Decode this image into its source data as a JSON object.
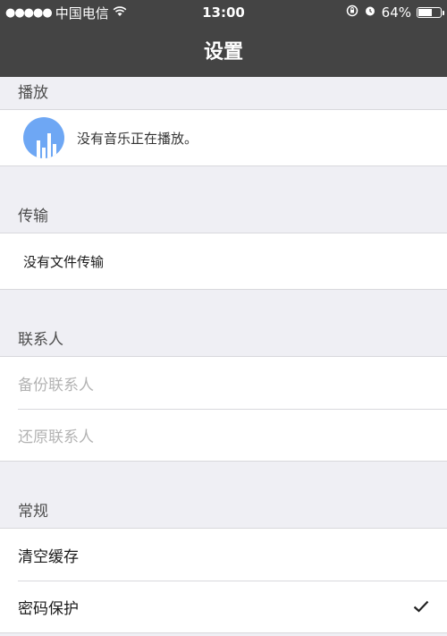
{
  "status_bar": {
    "signal": "●●●●●",
    "carrier": "中国电信",
    "time": "13:00",
    "battery_percent": "64%",
    "battery_level": 0.64
  },
  "nav": {
    "title": "设置"
  },
  "sections": {
    "playback": {
      "header": "播放",
      "status": "没有音乐正在播放。"
    },
    "transfer": {
      "header": "传输",
      "status": "没有文件传输"
    },
    "contacts": {
      "header": "联系人",
      "backup": "备份联系人",
      "restore": "还原联系人"
    },
    "general": {
      "header": "常规",
      "clear_cache": "清空缓存",
      "password_protect": "密码保护"
    }
  },
  "colors": {
    "nav_bg": "#444444",
    "accent": "#6ea7f4",
    "page_bg": "#efeff4"
  }
}
